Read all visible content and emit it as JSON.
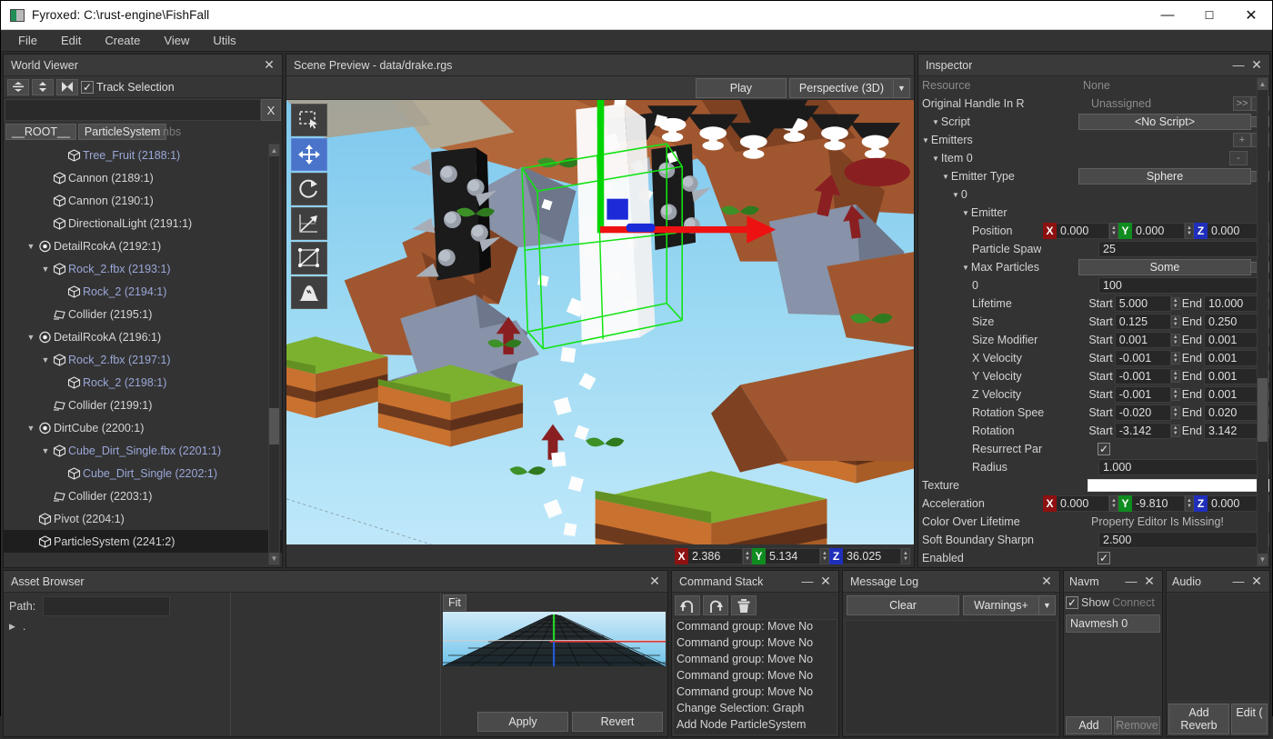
{
  "window": {
    "title": "Fyroxed: C:\\rust-engine\\FishFall",
    "minimize": "—",
    "maximize": "☐",
    "close": "✕"
  },
  "menu": [
    "File",
    "Edit",
    "Create",
    "View",
    "Utils"
  ],
  "world_viewer": {
    "title": "World Viewer",
    "close": "✕",
    "track_selection_label": "Track Selection",
    "track_selection_checked": "✓",
    "search_value": "",
    "search_clear": "X",
    "breadcrumbs": [
      "__ROOT__",
      "ParticleSystem"
    ],
    "breadcrumb_ghost": "nbs",
    "tree": [
      {
        "label": "Tree_Fruit (2188:1)",
        "indent": 3,
        "icon": "cube-icon",
        "arrow": "",
        "blue": true,
        "selected": false
      },
      {
        "label": "Cannon (2189:1)",
        "indent": 2,
        "icon": "cube-icon",
        "arrow": "",
        "blue": false,
        "selected": false
      },
      {
        "label": "Cannon (2190:1)",
        "indent": 2,
        "icon": "cube-icon",
        "arrow": "",
        "blue": false,
        "selected": false
      },
      {
        "label": "DirectionalLight (2191:1)",
        "indent": 2,
        "icon": "cube-icon",
        "arrow": "",
        "blue": false,
        "selected": false
      },
      {
        "label": "DetailRcokA (2192:1)",
        "indent": 1,
        "icon": "light-icon",
        "arrow": "▼",
        "blue": false,
        "selected": false
      },
      {
        "label": "Rock_2.fbx (2193:1)",
        "indent": 2,
        "icon": "cube-icon",
        "arrow": "▼",
        "blue": true,
        "selected": false
      },
      {
        "label": "Rock_2 (2194:1)",
        "indent": 3,
        "icon": "cube-icon",
        "arrow": "",
        "blue": true,
        "selected": false
      },
      {
        "label": "Collider (2195:1)",
        "indent": 2,
        "icon": "collider-icon",
        "arrow": "",
        "blue": false,
        "selected": false
      },
      {
        "label": "DetailRcokA (2196:1)",
        "indent": 1,
        "icon": "light-icon",
        "arrow": "▼",
        "blue": false,
        "selected": false
      },
      {
        "label": "Rock_2.fbx (2197:1)",
        "indent": 2,
        "icon": "cube-icon",
        "arrow": "▼",
        "blue": true,
        "selected": false
      },
      {
        "label": "Rock_2 (2198:1)",
        "indent": 3,
        "icon": "cube-icon",
        "arrow": "",
        "blue": true,
        "selected": false
      },
      {
        "label": "Collider (2199:1)",
        "indent": 2,
        "icon": "collider-icon",
        "arrow": "",
        "blue": false,
        "selected": false
      },
      {
        "label": "DirtCube (2200:1)",
        "indent": 1,
        "icon": "light-icon",
        "arrow": "▼",
        "blue": false,
        "selected": false
      },
      {
        "label": "Cube_Dirt_Single.fbx (2201:1)",
        "indent": 2,
        "icon": "cube-icon",
        "arrow": "▼",
        "blue": true,
        "selected": false
      },
      {
        "label": "Cube_Dirt_Single (2202:1)",
        "indent": 3,
        "icon": "cube-icon",
        "arrow": "",
        "blue": true,
        "selected": false
      },
      {
        "label": "Collider (2203:1)",
        "indent": 2,
        "icon": "collider-icon",
        "arrow": "",
        "blue": false,
        "selected": false
      },
      {
        "label": "Pivot (2204:1)",
        "indent": 1,
        "icon": "cube-icon",
        "arrow": "",
        "blue": false,
        "selected": false
      },
      {
        "label": "ParticleSystem (2241:2)",
        "indent": 1,
        "icon": "cube-icon",
        "arrow": "",
        "blue": false,
        "selected": true
      }
    ]
  },
  "scene_preview": {
    "title": "Scene Preview - data/drake.rgs",
    "play_label": "Play",
    "projection": "Perspective (3D)",
    "tools": [
      "select-icon",
      "move-icon",
      "rotate-icon",
      "scale-icon",
      "navmesh-icon",
      "terrain-icon"
    ],
    "active_tool_index": 1,
    "status": {
      "x": "2.386",
      "y": "5.134",
      "z": "36.025"
    }
  },
  "inspector": {
    "title": "Inspector",
    "minimize": "—",
    "close": "✕",
    "rows": [
      {
        "kind": "kv",
        "label": "Resource",
        "value": "None",
        "dim": true
      },
      {
        "kind": "handle",
        "label": "Original Handle In R",
        "value": "Unassigned",
        "b1": ">>",
        "b2": "*"
      },
      {
        "kind": "drop",
        "label": "Script",
        "value": "<No Script>",
        "tri": "▼",
        "indent": 1
      },
      {
        "kind": "emitters",
        "label": "Emitters",
        "add": "+",
        "less": "<",
        "tri": "▼",
        "indent": 0
      },
      {
        "kind": "item",
        "label": "Item 0",
        "minus": "-",
        "tri": "▼",
        "indent": 1
      },
      {
        "kind": "drop",
        "label": "Emitter Type",
        "value": "Sphere",
        "tri": "▼",
        "indent": 2
      },
      {
        "kind": "plain",
        "label": "0",
        "tri": "▼",
        "indent": 3
      },
      {
        "kind": "plain",
        "label": "Emitter",
        "tri": "▼",
        "indent": 4
      },
      {
        "kind": "vec3",
        "label": "Position",
        "x": "0.000",
        "y": "0.000",
        "z": "0.000",
        "indent": 5
      },
      {
        "kind": "num",
        "label": "Particle Spaw",
        "value": "25",
        "indent": 5
      },
      {
        "kind": "drop",
        "label": "Max Particles",
        "value": "Some",
        "tri": "▼",
        "indent": 4
      },
      {
        "kind": "num",
        "label": "0",
        "value": "100",
        "indent": 5
      },
      {
        "kind": "range",
        "label": "Lifetime",
        "start": "5.000",
        "end": "10.000",
        "indent": 5
      },
      {
        "kind": "range",
        "label": "Size",
        "start": "0.125",
        "end": "0.250",
        "indent": 5
      },
      {
        "kind": "range",
        "label": "Size Modifier",
        "start": "0.001",
        "end": "0.001",
        "indent": 5
      },
      {
        "kind": "range",
        "label": "X Velocity",
        "start": "-0.001",
        "end": "0.001",
        "indent": 5
      },
      {
        "kind": "range",
        "label": "Y Velocity",
        "start": "-0.001",
        "end": "0.001",
        "indent": 5
      },
      {
        "kind": "range",
        "label": "Z Velocity",
        "start": "-0.001",
        "end": "0.001",
        "indent": 5
      },
      {
        "kind": "range",
        "label": "Rotation Spee",
        "start": "-0.020",
        "end": "0.020",
        "indent": 5
      },
      {
        "kind": "range",
        "label": "Rotation",
        "start": "-3.142",
        "end": "3.142",
        "indent": 5
      },
      {
        "kind": "check",
        "label": "Resurrect Par",
        "checked": "✓",
        "indent": 5
      },
      {
        "kind": "num",
        "label": "Radius",
        "value": "1.000",
        "indent": 5
      },
      {
        "kind": "texture",
        "label": "Texture",
        "indent": 0
      },
      {
        "kind": "vec3",
        "label": "Acceleration",
        "x": "0.000",
        "y": "-9.810",
        "z": "0.000",
        "indent": 0
      },
      {
        "kind": "static",
        "label": "Color Over Lifetime",
        "value": "Property Editor Is Missing!",
        "indent": 0
      },
      {
        "kind": "num",
        "label": "Soft Boundary Sharpn",
        "value": "2.500",
        "indent": 0
      },
      {
        "kind": "check",
        "label": "Enabled",
        "checked": "✓",
        "indent": 0
      }
    ]
  },
  "asset_browser": {
    "title": "Asset Browser",
    "close": "✕",
    "path_label": "Path:",
    "path_value": "",
    "tree_root": ".",
    "tree_arrow": "▶",
    "fit_label": "Fit",
    "apply_label": "Apply",
    "revert_label": "Revert"
  },
  "command_stack": {
    "title": "Command Stack",
    "minimize": "—",
    "close": "✕",
    "tools": [
      "undo-icon",
      "redo-icon",
      "trash-icon"
    ],
    "items": [
      "Command group: Move No",
      "Command group: Move No",
      "Command group: Move No",
      "Command group: Move No",
      "Command group: Move No",
      "Change Selection: Graph",
      "Add Node ParticleSystem"
    ]
  },
  "message_log": {
    "title": "Message Log",
    "close": "✕",
    "clear_label": "Clear",
    "filter_label": "Warnings+",
    "messages": []
  },
  "navmesh": {
    "title": "Navm",
    "minimize": "—",
    "close": "✕",
    "show_label": "Show",
    "show_checked": "✓",
    "connect_label": "Connect",
    "items": [
      "Navmesh 0"
    ],
    "add_label": "Add",
    "remove_label": "Remove"
  },
  "audio": {
    "title": "Audio",
    "minimize": "—",
    "close": "✕",
    "add_reverb_label": "Add Reverb",
    "edit_label": "Edit ("
  },
  "colors": {
    "accent_blue": "#4a74c9",
    "axis_x": "#8e1111",
    "axis_y": "#0f8c1f",
    "axis_z": "#1f2fbb",
    "gizmo_green": "#00e000",
    "sky": "#87ceeb"
  }
}
